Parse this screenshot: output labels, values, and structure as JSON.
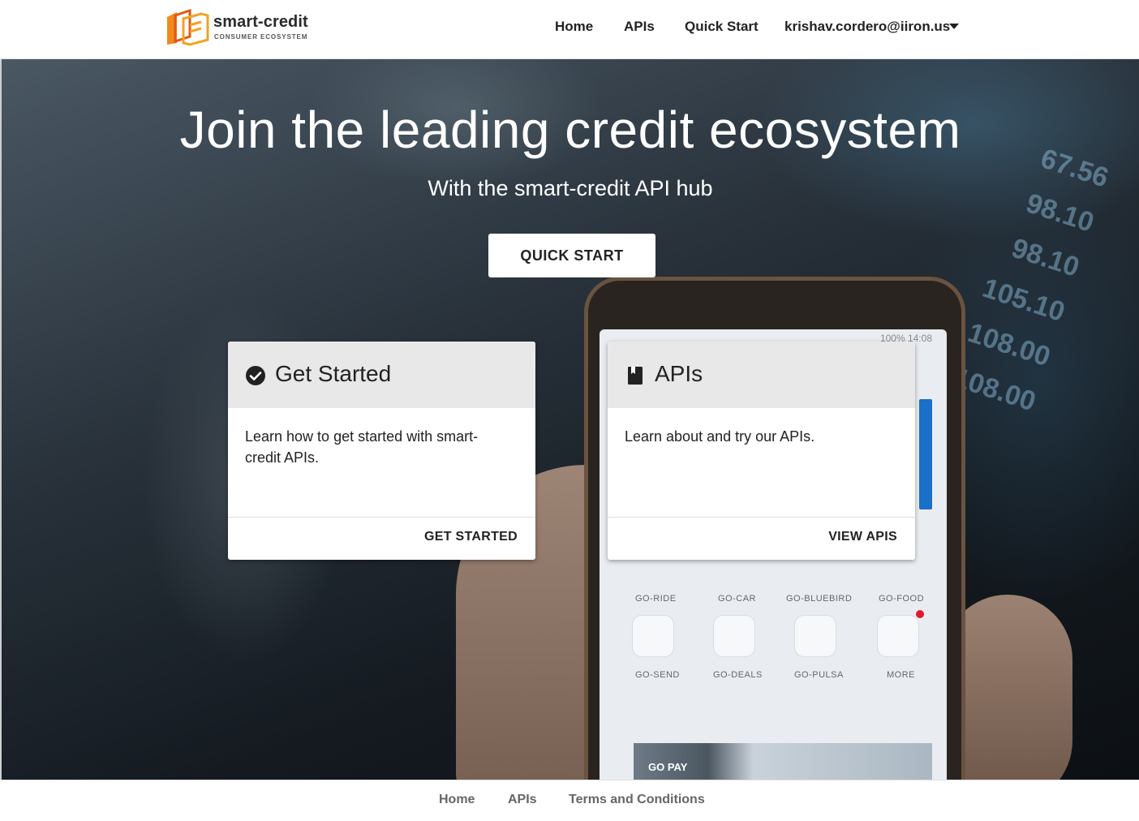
{
  "brand": {
    "name": "smart-credit",
    "tagline": "CONSUMER ECOSYSTEM",
    "accent": "#f08a1e",
    "accent_dark": "#e05a12"
  },
  "nav": {
    "home": "Home",
    "apis": "APIs",
    "quick_start": "Quick Start",
    "user_email": "krishav.cordero@iiron.us"
  },
  "hero": {
    "title": "Join the leading credit ecosystem",
    "subtitle": "With the smart-credit API hub",
    "cta_label": "QUICK START"
  },
  "cards": [
    {
      "title": "Get Started",
      "icon": "check-circle-icon",
      "description": "Learn how to get started with smart-credit APIs.",
      "action": "GET STARTED"
    },
    {
      "title": "APIs",
      "icon": "book-icon",
      "description": "Learn about and try our APIs.",
      "action": "VIEW APIS"
    }
  ],
  "background_phone": {
    "status": "100% 14:08",
    "apps_row1": [
      "GO-RIDE",
      "GO-CAR",
      "GO-BLUEBIRD",
      "GO-FOOD"
    ],
    "apps_row2": [
      "GO-SEND",
      "GO-DEALS",
      "GO-PULSA",
      "MORE"
    ],
    "banner": "GO PAY",
    "screen_values": [
      "67.56",
      "98.10",
      "98.10",
      "105.10",
      "108.00",
      "108.00"
    ]
  },
  "footer": {
    "home": "Home",
    "apis": "APIs",
    "terms": "Terms and Conditions"
  }
}
